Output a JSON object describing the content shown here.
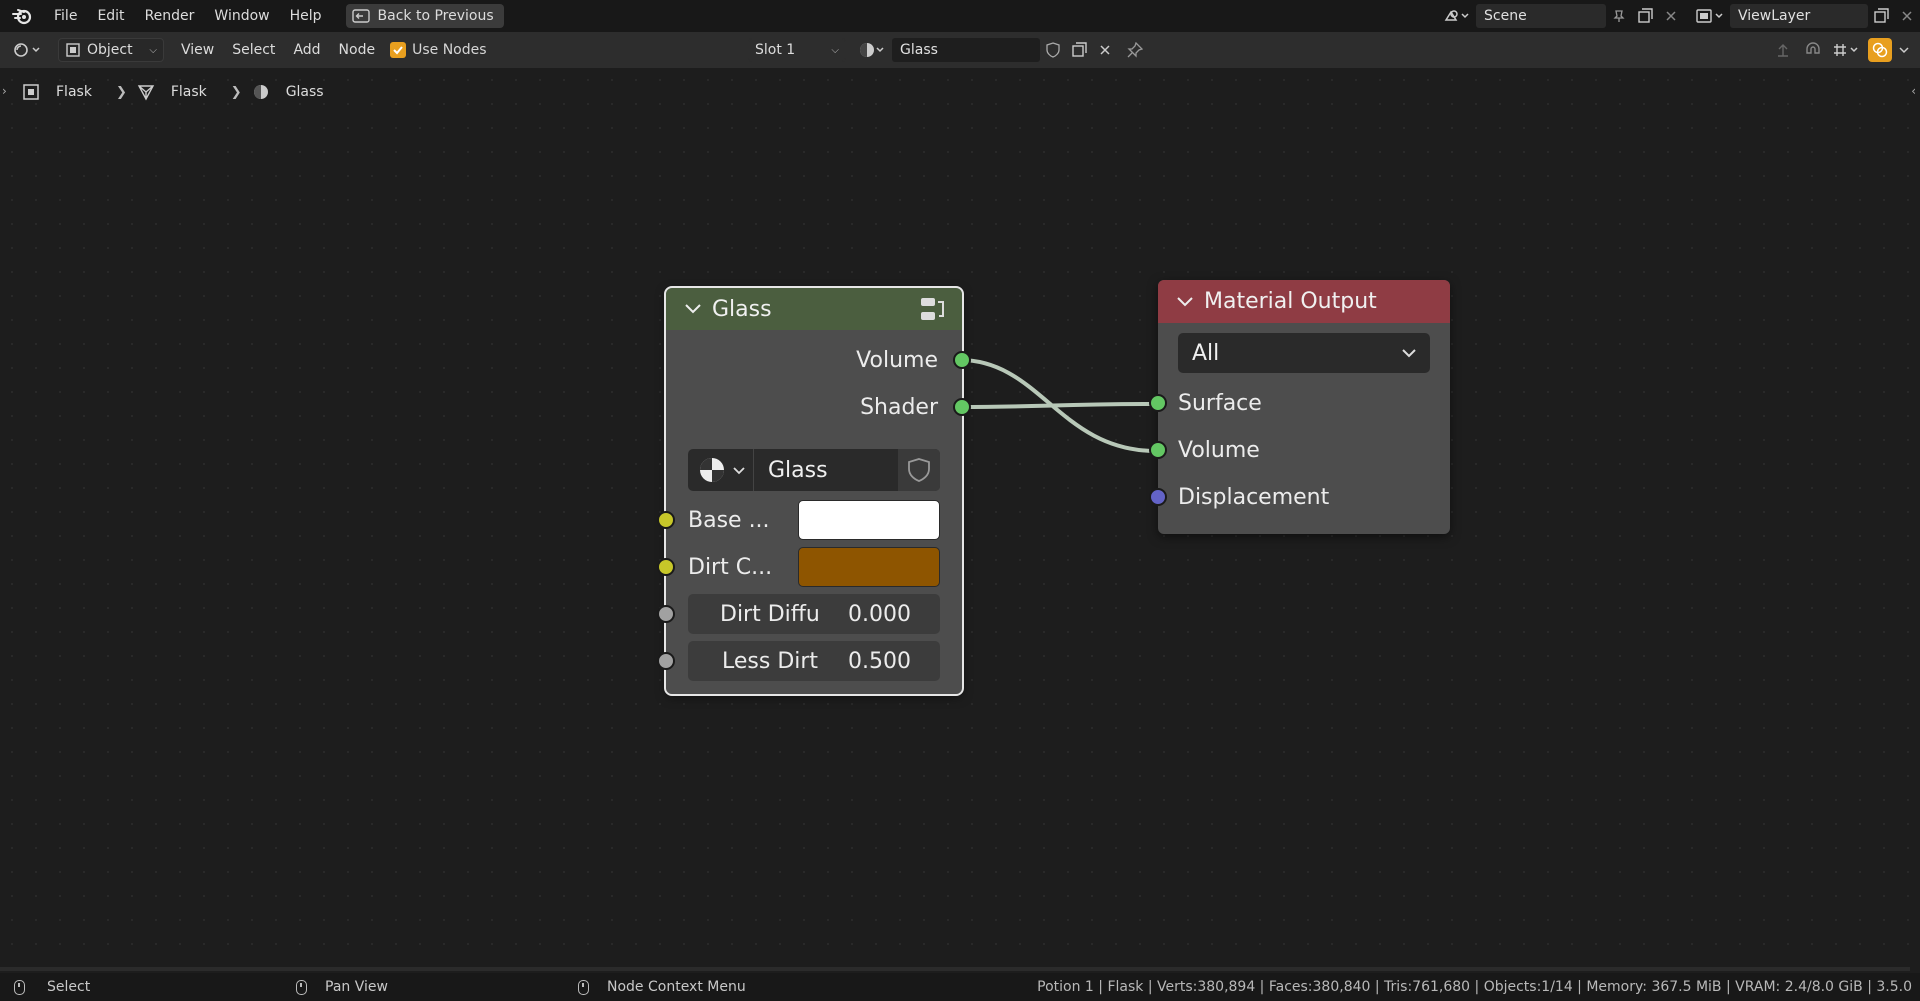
{
  "topbar": {
    "menu": [
      "File",
      "Edit",
      "Render",
      "Window",
      "Help"
    ],
    "back_label": "Back to Previous",
    "scene": "Scene",
    "view_layer": "ViewLayer"
  },
  "header": {
    "object_mode": "Object",
    "menus": [
      "View",
      "Select",
      "Add",
      "Node"
    ],
    "use_nodes_label": "Use Nodes",
    "use_nodes_checked": true,
    "slot": "Slot 1",
    "material": "Glass"
  },
  "breadcrumb": {
    "object": "Flask",
    "mesh": "Flask",
    "material": "Glass"
  },
  "glass_node": {
    "title": "Glass",
    "outputs": [
      "Volume",
      "Shader"
    ],
    "group_name": "Glass",
    "inputs": {
      "base_label": "Base ...",
      "base_color": "#ffffff",
      "dirt_label": "Dirt C...",
      "dirt_color": "#8e5500",
      "dirt_diffuse_label": "Dirt Diffu",
      "dirt_diffuse_value": "0.000",
      "less_dirt_label": "Less Dirt",
      "less_dirt_value": "0.500"
    }
  },
  "output_node": {
    "title": "Material Output",
    "target": "All",
    "inputs": [
      "Surface",
      "Volume",
      "Displacement"
    ]
  },
  "statusbar": {
    "select": "Select",
    "pan": "Pan View",
    "context": "Node Context Menu",
    "stats": "Potion 1 | Flask | Verts:380,894 | Faces:380,840 | Tris:761,680 | Objects:1/14 | Memory: 367.5 MiB | VRAM: 2.4/8.0 GiB | 3.5.0"
  },
  "colors": {
    "glass_header": "#4b5e3f",
    "output_header": "#8f3c44",
    "accent": "#e89f1f"
  }
}
